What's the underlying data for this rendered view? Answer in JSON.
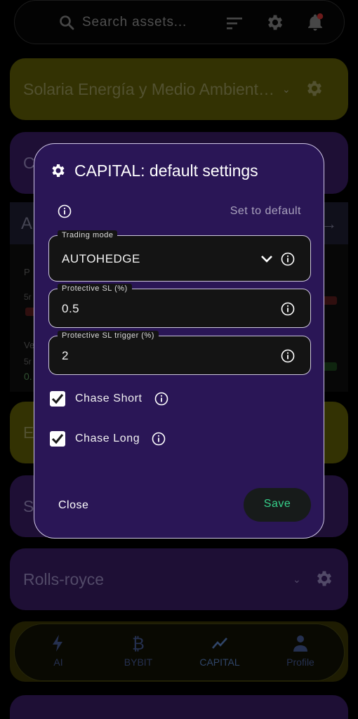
{
  "topbar": {
    "search_placeholder": "Search assets..."
  },
  "cards": {
    "solaria": {
      "name": "Solaria Energía y Medio Ambient…"
    },
    "c_card": {
      "name": "C"
    },
    "expanded": {
      "name": "A",
      "label_p": "P",
      "label_5m_a": "5r",
      "label_v": "Ve",
      "label_5m_b": "5r",
      "label_0": "0."
    },
    "e_card": {
      "name": "E"
    },
    "s_card": {
      "name": "S"
    },
    "rolls": {
      "name": "Rolls-royce"
    }
  },
  "bottom_nav": {
    "items": [
      {
        "label": "AI",
        "icon": "bolt-icon"
      },
      {
        "label": "BYBIT",
        "icon": "bitcoin-icon"
      },
      {
        "label": "CAPITAL",
        "icon": "trend-icon"
      },
      {
        "label": "Profile",
        "icon": "person-icon"
      }
    ]
  },
  "dialog": {
    "title": "CAPITAL: default settings",
    "set_default": "Set to default",
    "trading_mode": {
      "label": "Trading mode",
      "value": "AUTOHEDGE"
    },
    "protective_sl": {
      "label": "Protective SL (%)",
      "value": "0.5"
    },
    "protective_sl_trigger": {
      "label": "Protective SL trigger (%)",
      "value": "2"
    },
    "chase_short": {
      "label": "Chase Short",
      "checked": true
    },
    "chase_long": {
      "label": "Chase Long",
      "checked": true
    },
    "close_label": "Close",
    "save_label": "Save"
  },
  "colors": {
    "accent_green": "#36d08a",
    "dialog_bg": "#2a1656",
    "card_olive": "#4f4d06",
    "card_purple": "#2e1752"
  }
}
